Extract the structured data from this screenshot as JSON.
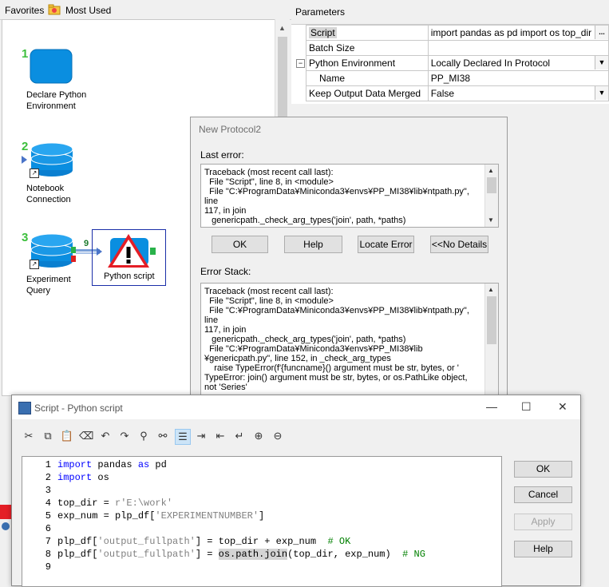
{
  "toolbar_top": {
    "favorites": "Favorites",
    "most_used": "Most Used"
  },
  "canvas": {
    "nodes": [
      {
        "step": "1",
        "label1": "Declare Python",
        "label2": "Environment"
      },
      {
        "step": "2",
        "label1": "Notebook",
        "label2": "Connection"
      },
      {
        "step": "3",
        "label1": "Experiment",
        "label2": "Query"
      },
      {
        "label1": "Python script"
      }
    ],
    "link_count": "9"
  },
  "parameters": {
    "title": "Parameters",
    "rows": [
      {
        "key": "Script",
        "value": "import pandas as pd import os  top_dir = r'E:\\work'"
      },
      {
        "key": "Batch Size",
        "value": ""
      },
      {
        "key": "Python Environment",
        "value": "Locally Declared In Protocol"
      },
      {
        "key": "Name",
        "value": "PP_MI38"
      },
      {
        "key": "Keep Output Data Merged",
        "value": "False"
      }
    ]
  },
  "new_protocol": {
    "title": "New Protocol2",
    "last_error_label": "Last error:",
    "last_error_text": "Traceback (most recent call last):\n  File \"Script\", line 8, in <module>\n  File \"C:¥ProgramData¥Miniconda3¥envs¥PP_MI38¥lib¥ntpath.py\", line\n117, in join\n   genericpath._check_arg_types('join', path, *paths)",
    "buttons": [
      "OK",
      "Help",
      "Locate Error",
      "<<No Details"
    ],
    "error_stack_label": "Error Stack:",
    "error_stack_text": "Traceback (most recent call last):\n  File \"Script\", line 8, in <module>\n  File \"C:¥ProgramData¥Miniconda3¥envs¥PP_MI38¥lib¥ntpath.py\", line\n117, in join\n   genericpath._check_arg_types('join', path, *paths)\n  File \"C:¥ProgramData¥Miniconda3¥envs¥PP_MI38¥lib\n¥genericpath.py\", line 152, in _check_arg_types\n    raise TypeError(f'{funcname}() argument must be str, bytes, or '\nTypeError: join() argument must be str, bytes, or os.PathLike object,\nnot 'Series'"
  },
  "script_dialog": {
    "title": "Script - Python script",
    "line_numbers": [
      "1",
      "2",
      "3",
      "4",
      "5",
      "6",
      "7",
      "8",
      "9"
    ],
    "buttons": [
      "OK",
      "Cancel",
      "Apply",
      "Help"
    ]
  }
}
